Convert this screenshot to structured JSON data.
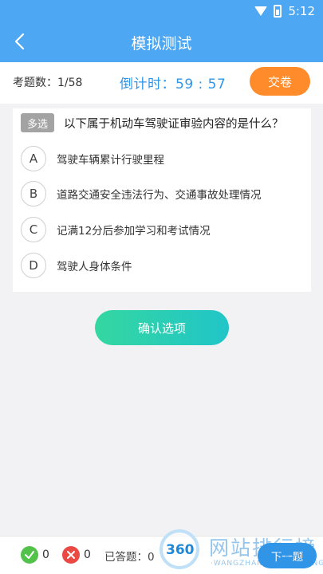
{
  "status": {
    "time": "5:12"
  },
  "header": {
    "title": "模拟测试"
  },
  "info": {
    "question_count": "考题数：1/58",
    "countdown": "倒计时：59 : 57",
    "submit_label": "交卷"
  },
  "question": {
    "tag": "多选",
    "text": "以下属于机动车驾驶证审验内容的是什么？",
    "options": [
      {
        "letter": "A",
        "text": "驾驶车辆累计行驶里程"
      },
      {
        "letter": "B",
        "text": "道路交通安全违法行为、交通事故处理情况"
      },
      {
        "letter": "C",
        "text": "记满12分后参加学习和考试情况"
      },
      {
        "letter": "D",
        "text": "驾驶人身体条件"
      }
    ]
  },
  "confirm_label": "确认选项",
  "footer": {
    "correct_count": "0",
    "wrong_count": "0",
    "answered": "已答题：0",
    "next_label": "下一题"
  },
  "watermark": {
    "logo_num": "360",
    "text": "网站排行榜",
    "sub": "·WANGZHANPAIHANGBANG"
  }
}
